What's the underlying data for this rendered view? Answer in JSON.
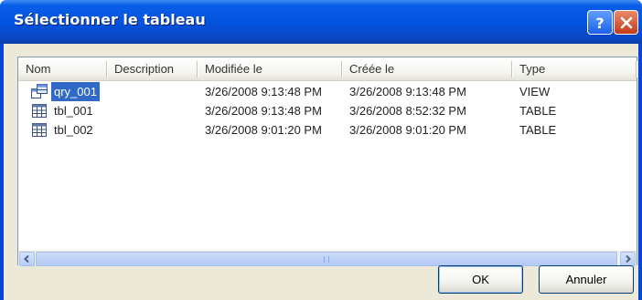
{
  "window": {
    "title": "Sélectionner le tableau"
  },
  "titlebar_buttons": {
    "help_icon": "help-icon",
    "close_icon": "close-icon"
  },
  "list": {
    "columns": [
      {
        "label": "Nom"
      },
      {
        "label": "Description"
      },
      {
        "label": "Modifiée le"
      },
      {
        "label": "Créée le"
      },
      {
        "label": "Type"
      }
    ],
    "rows": [
      {
        "name": "qry_001",
        "description": "",
        "modified": "3/26/2008 9:13:48 PM",
        "created": "3/26/2008 9:13:48 PM",
        "type": "VIEW",
        "icon": "view-icon",
        "selected": true
      },
      {
        "name": "tbl_001",
        "description": "",
        "modified": "3/26/2008 9:13:48 PM",
        "created": "3/26/2008 8:52:32 PM",
        "type": "TABLE",
        "icon": "table-icon",
        "selected": false
      },
      {
        "name": "tbl_002",
        "description": "",
        "modified": "3/26/2008 9:01:20 PM",
        "created": "3/26/2008 9:01:20 PM",
        "type": "TABLE",
        "icon": "table-icon",
        "selected": false
      }
    ]
  },
  "buttons": {
    "ok_label": "OK",
    "cancel_label": "Annuler"
  },
  "colors": {
    "titlebar": "#0454e0",
    "selection": "#3169c6",
    "face": "#ece9d8"
  }
}
